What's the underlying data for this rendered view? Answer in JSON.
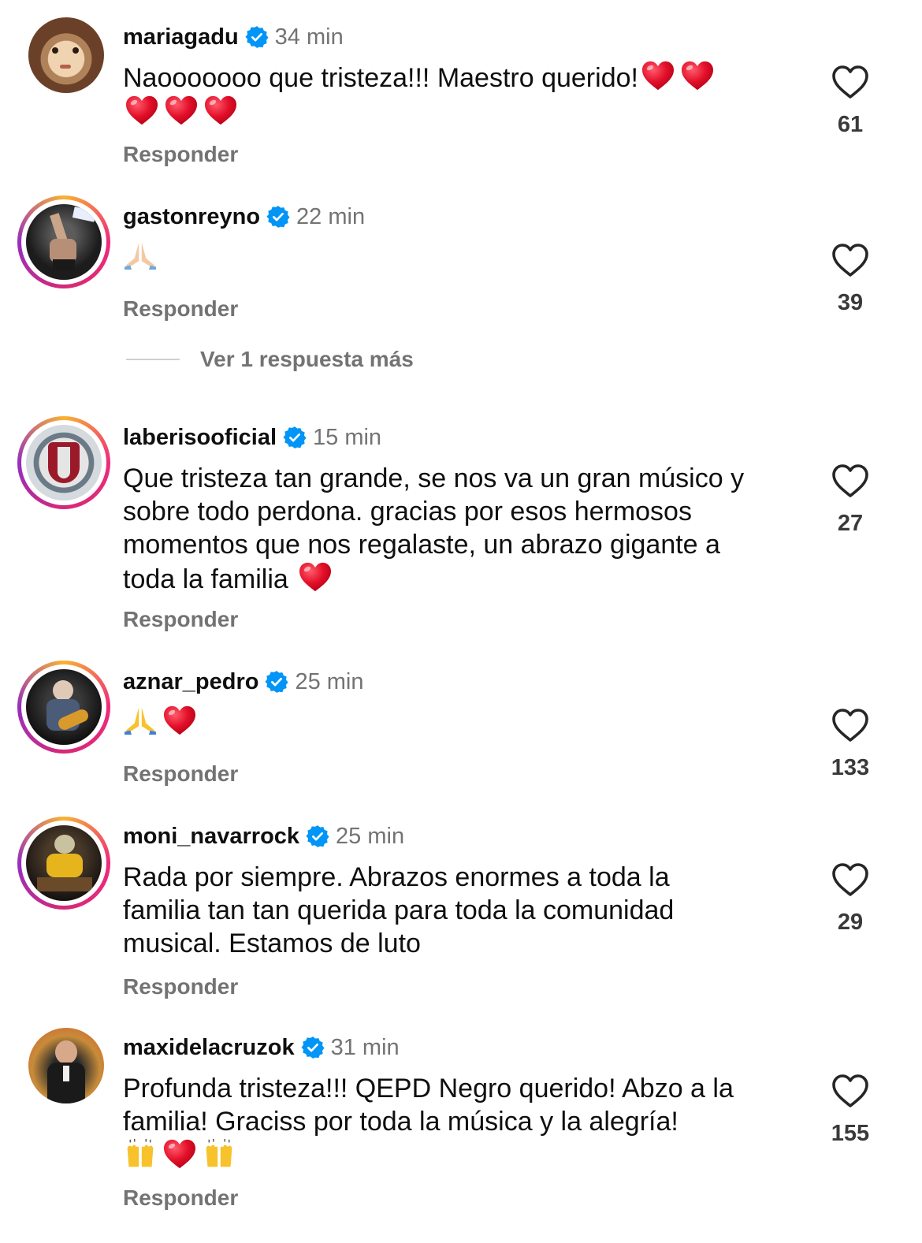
{
  "comments": [
    {
      "username": "mariagadu",
      "time": "34 min",
      "text": "Naooooooo que tristeza!!! Maestro querido!",
      "emojis": [
        "red-heart",
        "red-heart",
        "red-heart",
        "red-heart",
        "red-heart"
      ],
      "reply_label": "Responder",
      "likes": "61",
      "story_ring": false
    },
    {
      "username": "gastonreyno",
      "time": "22 min",
      "text": "",
      "emojis": [
        "folded-hands"
      ],
      "reply_label": "Responder",
      "likes": "39",
      "story_ring": true,
      "more_replies": "Ver 1 respuesta más"
    },
    {
      "username": "laberisooficial",
      "time": "15 min",
      "text": "Que tristeza tan grande, se nos va un gran músico y sobre todo perdona. gracias por esos hermosos momentos que nos regalaste, un abrazo gigante a toda la familia",
      "emojis": [
        "red-heart"
      ],
      "reply_label": "Responder",
      "likes": "27",
      "story_ring": true
    },
    {
      "username": "aznar_pedro",
      "time": "25 min",
      "text": "",
      "emojis": [
        "folded-hands",
        "red-heart"
      ],
      "reply_label": "Responder",
      "likes": "133",
      "story_ring": true
    },
    {
      "username": "moni_navarrock",
      "time": "25 min",
      "text": "Rada por siempre. Abrazos enormes a toda la familia tan tan querida para toda la comunidad musical. Estamos de luto",
      "emojis": [],
      "reply_label": "Responder",
      "likes": "29",
      "story_ring": true
    },
    {
      "username": "maxidelacruzok",
      "time": "31 min",
      "text": "Profunda tristeza!!! QEPD Negro querido! Abzo a la familia! Graciss por toda la música y la alegría!",
      "emojis": [
        "raising-hands",
        "red-heart",
        "raising-hands"
      ],
      "reply_label": "Responder",
      "likes": "155",
      "story_ring": false
    }
  ],
  "colors": {
    "verified": "#0095f6",
    "meta_gray": "#737373",
    "heart_red": "#e0142b"
  }
}
